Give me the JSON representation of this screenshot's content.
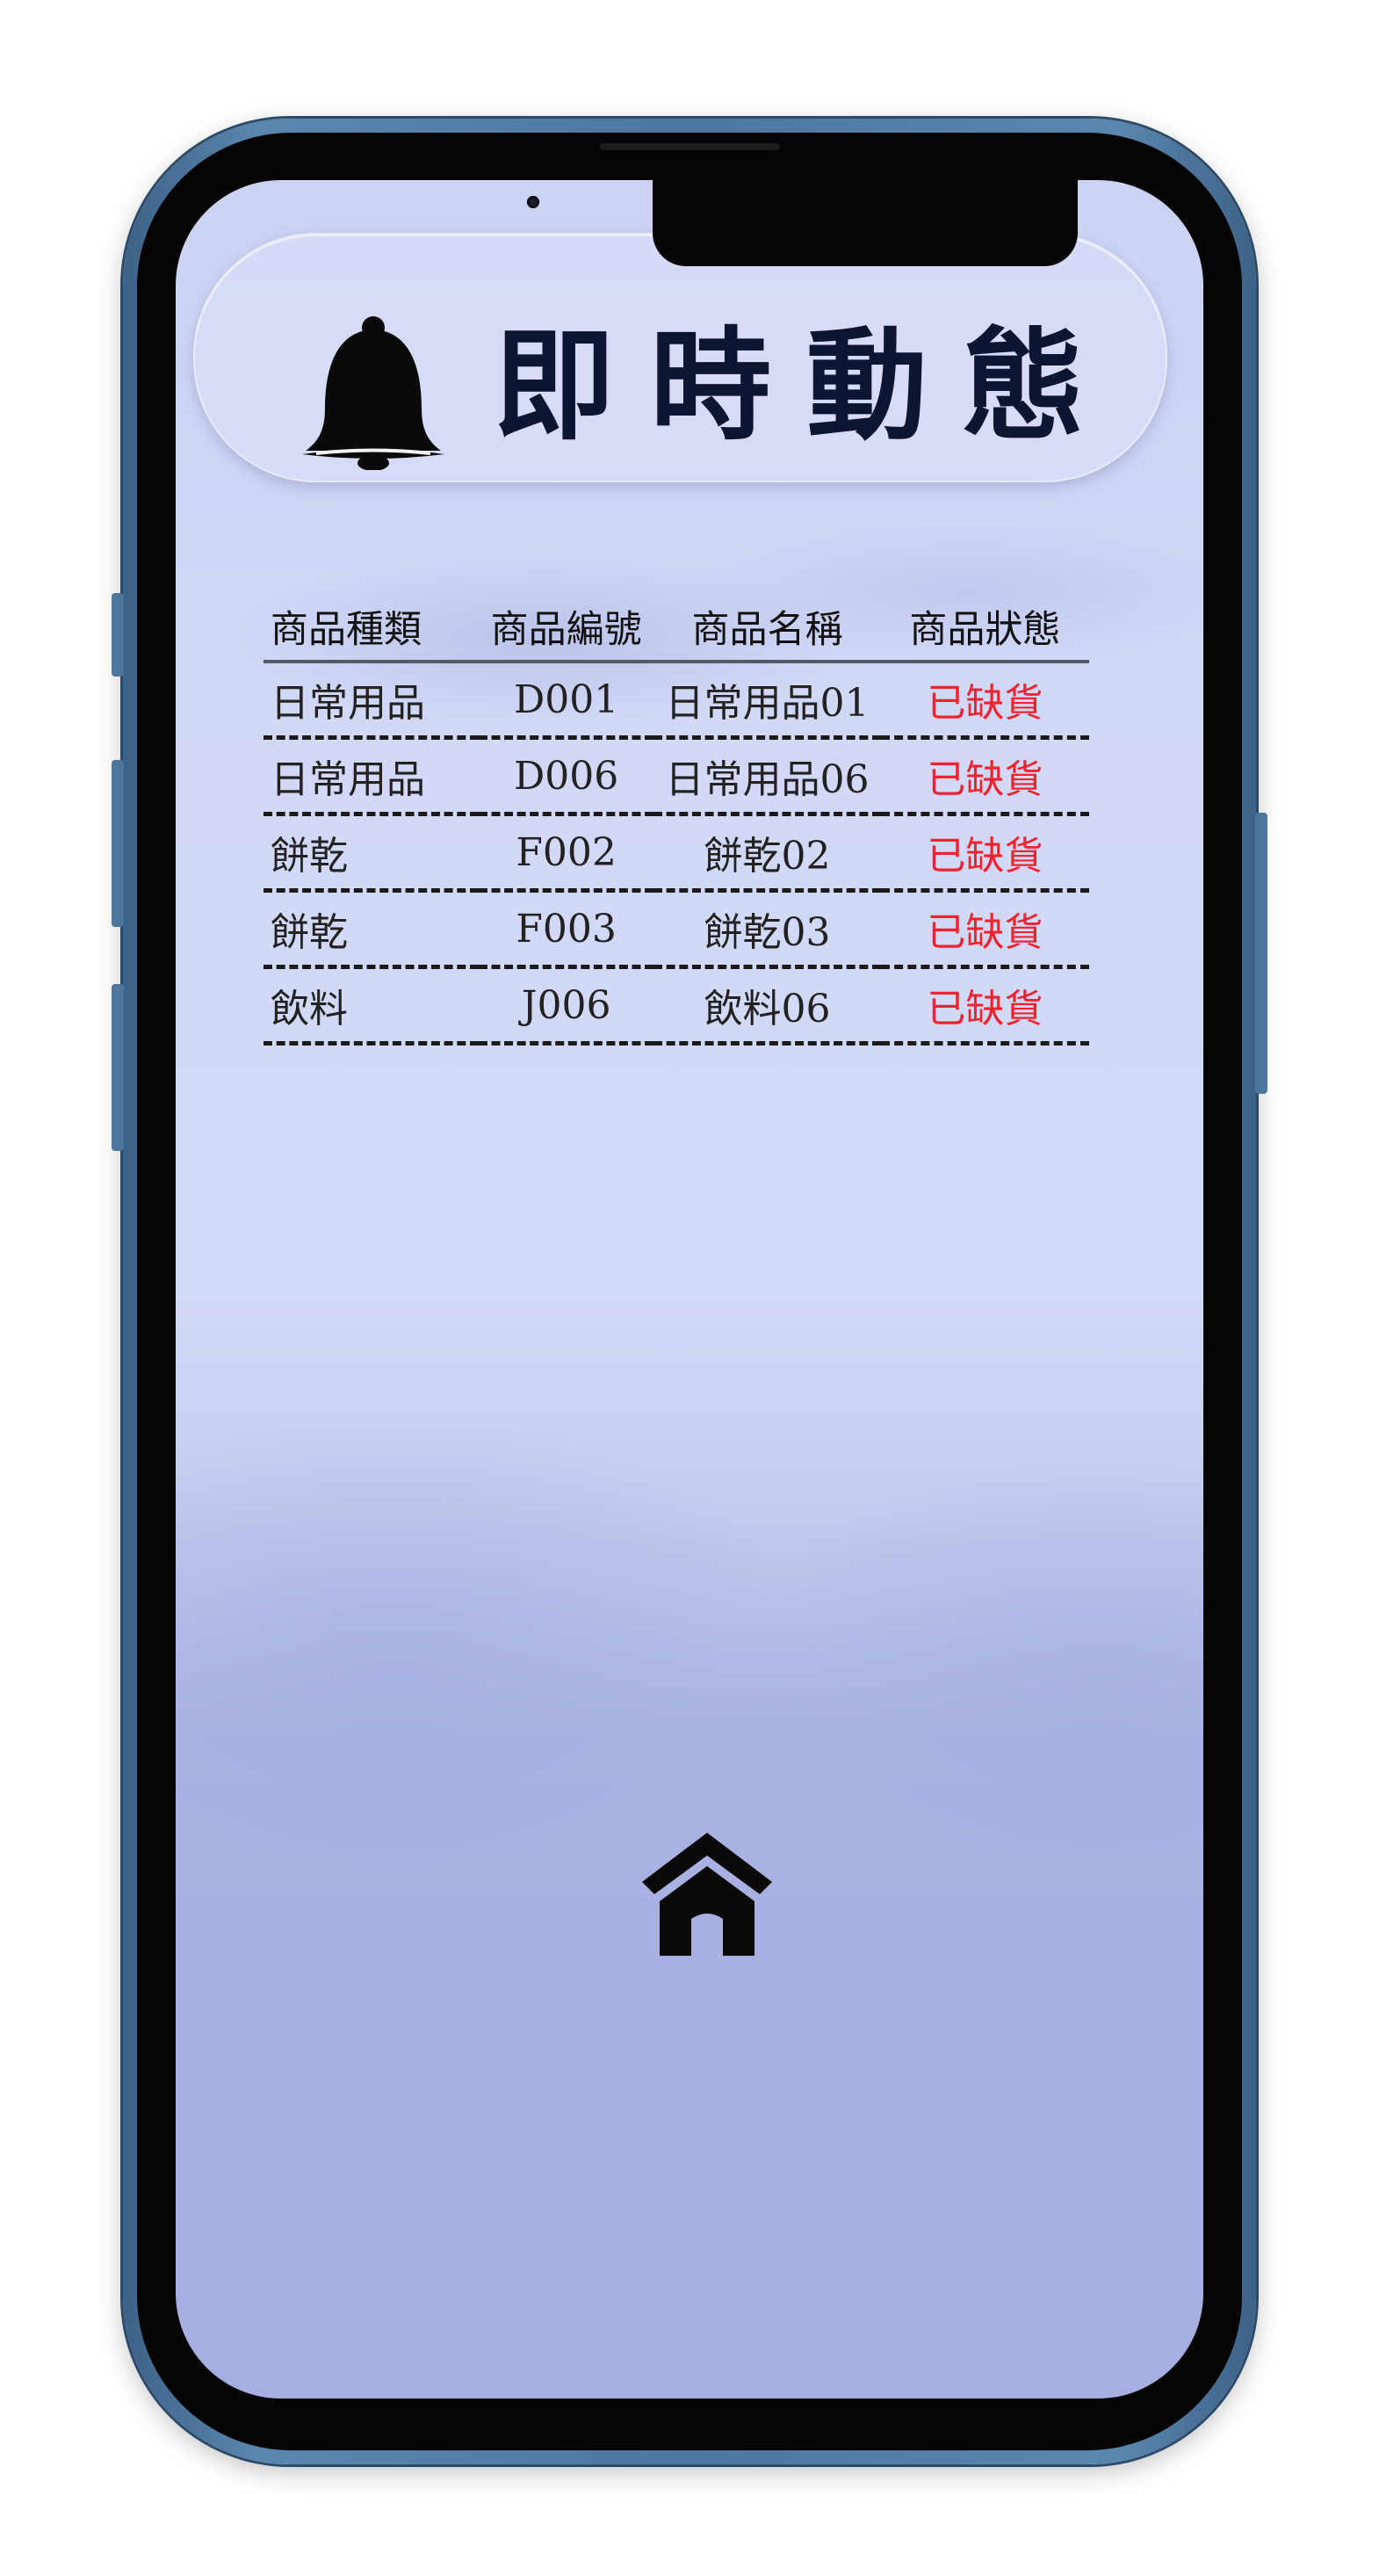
{
  "header": {
    "title": "即時動態",
    "icon": "bell-icon"
  },
  "table": {
    "columns": [
      "商品種類",
      "商品編號",
      "商品名稱",
      "商品狀態"
    ],
    "rows": [
      {
        "category": "日常用品",
        "code": "D001",
        "name": "日常用品01",
        "status": "已缺貨"
      },
      {
        "category": "日常用品",
        "code": "D006",
        "name": "日常用品06",
        "status": "已缺貨"
      },
      {
        "category": "餅乾",
        "code": "F002",
        "name": "餅乾02",
        "status": "已缺貨"
      },
      {
        "category": "餅乾",
        "code": "F003",
        "name": "餅乾03",
        "status": "已缺貨"
      },
      {
        "category": "飲料",
        "code": "J006",
        "name": "飲料06",
        "status": "已缺貨"
      }
    ]
  },
  "footer": {
    "home_icon": "home-icon"
  },
  "colors": {
    "status_red": "#f0222e",
    "background_top": "#ccd2f2",
    "background_bottom": "#a7afe1",
    "frame_blue": "#4d779f"
  }
}
